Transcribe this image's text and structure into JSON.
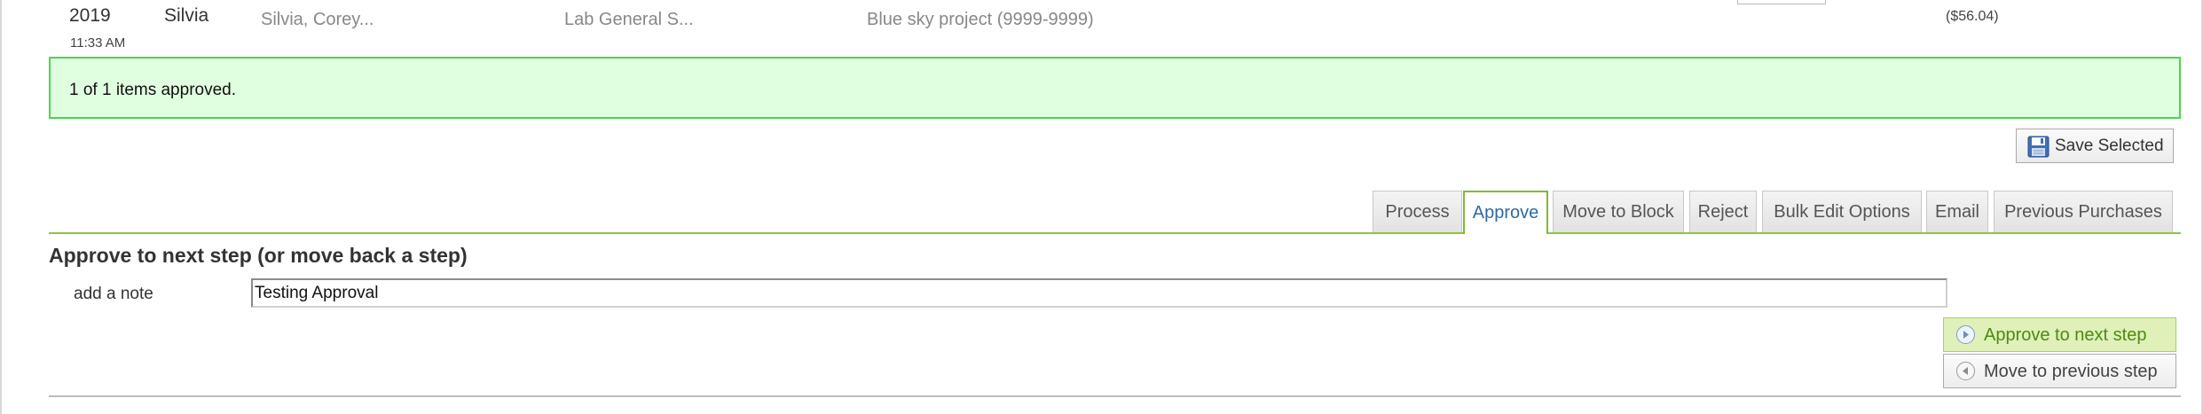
{
  "row": {
    "year": "2019",
    "time": "11:33 AM",
    "name": "Silvia",
    "requester": "Silvia, Corey...",
    "department": "Lab General S...",
    "project": "Blue sky project (9999-9999)",
    "amount": "($56.04)"
  },
  "notice": {
    "text": "1 of 1 items approved."
  },
  "toolbar": {
    "save_label": "Save Selected"
  },
  "tabs": [
    {
      "label": "Process",
      "active": false
    },
    {
      "label": "Approve",
      "active": true
    },
    {
      "label": "Move to Block",
      "active": false
    },
    {
      "label": "Reject",
      "active": false
    },
    {
      "label": "Bulk Edit Options",
      "active": false
    },
    {
      "label": "Email",
      "active": false
    },
    {
      "label": "Previous Purchases",
      "active": false
    }
  ],
  "approve_panel": {
    "title": "Approve to next step (or move back a step)",
    "note_label": "add a note",
    "note_value": "Testing Approval",
    "approve_button": "Approve to next step",
    "previous_button": "Move to previous step"
  },
  "colors": {
    "notice_bg": "#e0ffe0",
    "notice_border": "#4cd54c",
    "tab_accent": "#8cc63f",
    "active_tab_text": "#2d6aa3",
    "approve_button_bg": "#dff0b8"
  },
  "icons": {
    "save": "floppy-disk-icon",
    "approve": "circle-arrow-right-icon",
    "previous": "circle-arrow-left-icon"
  }
}
